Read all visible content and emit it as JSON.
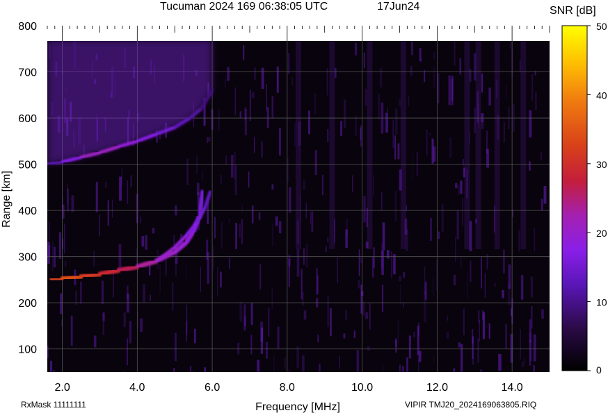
{
  "header": {
    "title": "Tucuman 2024 169 06:38:05 UTC",
    "date": "17Jun24"
  },
  "footer": {
    "left": "RxMask 11111111",
    "right": "VIPIR  TMJ20_2024169063805.RIQ"
  },
  "colorbar": {
    "label": "SNR [dB]",
    "ticks": [
      0,
      10,
      20,
      30,
      40,
      50
    ],
    "range": [
      0,
      50
    ]
  },
  "colors": {
    "background": "#08030c",
    "low": "#000000",
    "mid": "#7a1fe0",
    "high": "#d21c28",
    "peak": "#ffff00"
  },
  "chart_data": {
    "type": "heatmap",
    "title": "Tucuman 2024 169 06:38:05 UTC",
    "xlabel": "Frequency [MHz]",
    "ylabel": "Range [km]",
    "xlim": [
      1.6,
      15.0
    ],
    "ylim": [
      50,
      800
    ],
    "xticks": [
      2.0,
      4.0,
      6.0,
      8.0,
      10.0,
      12.0,
      14.0
    ],
    "xtick_labels": [
      "2.0",
      "4.0",
      "6.0",
      "8.0",
      "10.0",
      "12.0",
      "14.0"
    ],
    "yticks": [
      100,
      200,
      300,
      400,
      500,
      600,
      700,
      800
    ],
    "grid": true,
    "colorbar": {
      "label": "SNR [dB]",
      "min": 0,
      "max": 50
    },
    "traces": [
      {
        "frequency_mhz": [
          1.7,
          2.0,
          2.5,
          3.0,
          3.5,
          4.0,
          4.5,
          5.0,
          5.3,
          5.5,
          5.65,
          5.75
        ],
        "range_km": [
          250,
          252,
          257,
          262,
          270,
          278,
          290,
          310,
          330,
          355,
          385,
          440
        ],
        "snr_db": [
          30,
          35,
          33,
          30,
          28,
          25,
          22,
          20,
          20,
          18,
          16,
          14
        ]
      },
      {
        "frequency_mhz": [
          4.6,
          5.0,
          5.3,
          5.6,
          5.8,
          5.95
        ],
        "range_km": [
          295,
          320,
          345,
          375,
          405,
          440
        ],
        "snr_db": [
          20,
          20,
          18,
          16,
          14,
          12
        ]
      },
      {
        "frequency_mhz": [
          1.6,
          2.0,
          2.5,
          3.0,
          3.5,
          4.0,
          4.5,
          5.0,
          5.4,
          5.7,
          6.0
        ],
        "range_km": [
          500,
          505,
          515,
          525,
          538,
          550,
          565,
          580,
          600,
          620,
          660
        ],
        "snr_db": [
          10,
          14,
          20,
          22,
          20,
          18,
          16,
          14,
          12,
          10,
          8
        ]
      }
    ]
  }
}
